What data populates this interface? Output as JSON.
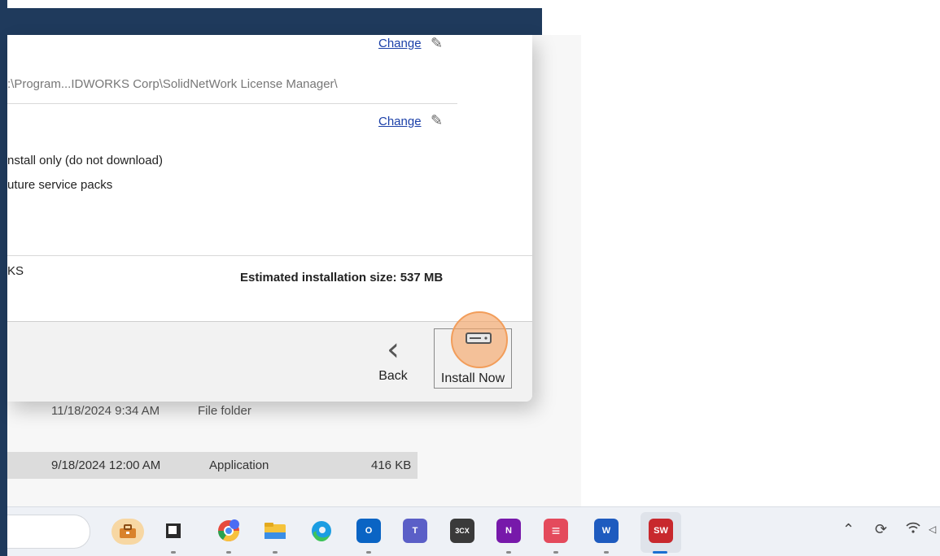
{
  "dialog": {
    "change_link_1": "Change",
    "install_path": ":\\Program...IDWORKS Corp\\SolidNetWork License Manager\\",
    "change_link_2": "Change",
    "option_1": "nstall only (do not download)",
    "option_2": "uture service packs",
    "product_fragment": "KS",
    "estimated_size": "Estimated installation size: 537 MB",
    "back_label": "Back",
    "install_label": "Install Now"
  },
  "explorer": {
    "rows": [
      {
        "date": "11/18/2024 9:34 AM",
        "type": "File folder",
        "size": ""
      },
      {
        "date": "9/18/2024 12:00 AM",
        "type": "Application",
        "size": "416 KB"
      }
    ]
  },
  "taskbar": {
    "apps": [
      {
        "name": "work-briefcase",
        "label": ""
      },
      {
        "name": "notepad-app",
        "label": ""
      },
      {
        "name": "chrome-app",
        "label": ""
      },
      {
        "name": "file-explorer-app",
        "label": ""
      },
      {
        "name": "edge-app",
        "label": ""
      },
      {
        "name": "outlook-app",
        "label": "O"
      },
      {
        "name": "teams-app",
        "label": "T"
      },
      {
        "name": "3cx-app",
        "label": "3CX"
      },
      {
        "name": "onenote-app",
        "label": "N"
      },
      {
        "name": "todoist-app",
        "label": ""
      },
      {
        "name": "word-app",
        "label": "W"
      },
      {
        "name": "solidworks-app",
        "label": "SW"
      }
    ]
  },
  "colors": {
    "title_bar": "#1f3a5c",
    "link": "#1a3fa8",
    "highlight": "#f4a668",
    "active_indicator": "#1a6fd1"
  }
}
